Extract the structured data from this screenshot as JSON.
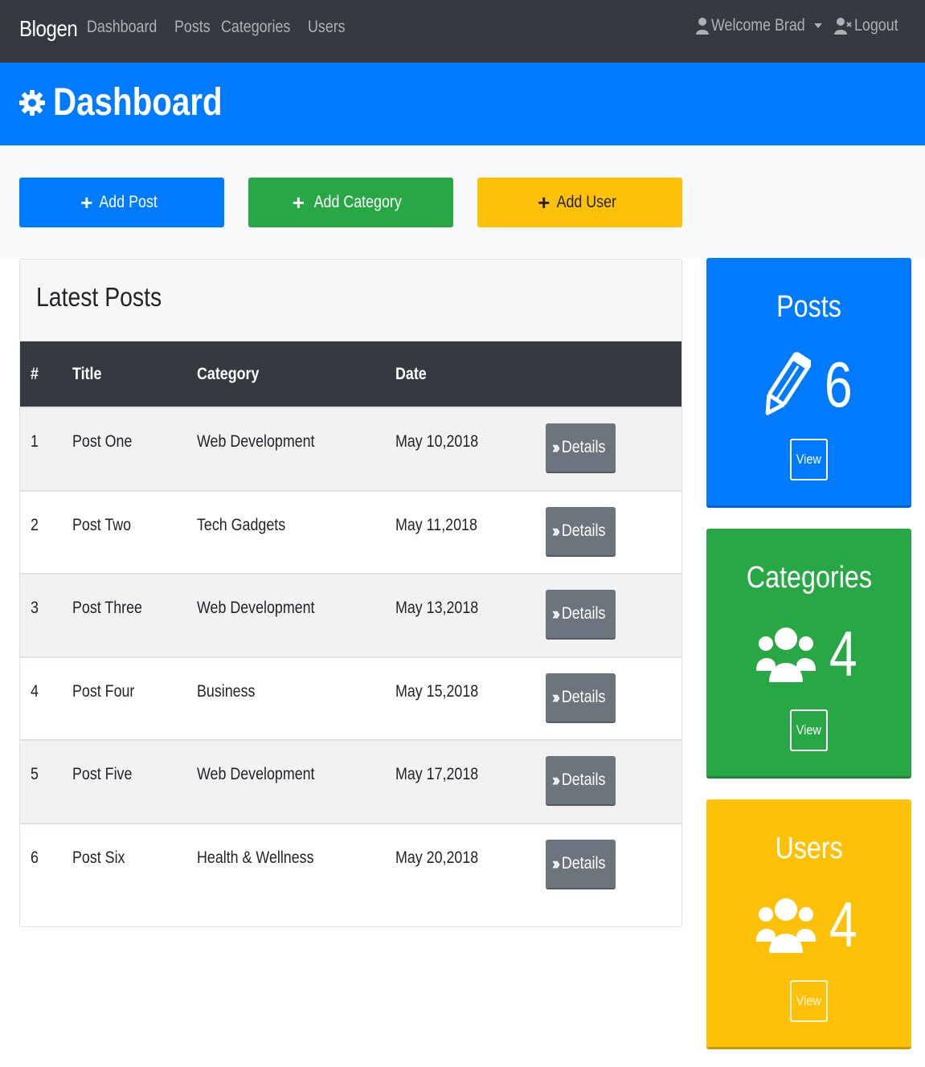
{
  "navbar": {
    "brand": "Blogen",
    "links": [
      "Dashboard",
      "Posts",
      "Categories",
      "Users"
    ],
    "welcome": "Welcome Brad",
    "logout": "Logout"
  },
  "header": {
    "title": "Dashboard",
    "icon": "gear-icon"
  },
  "actions": {
    "add_post": "Add Post",
    "add_category": "Add Category",
    "add_user": "Add User"
  },
  "latest_posts": {
    "title": "Latest Posts",
    "columns": [
      "#",
      "Title",
      "Category",
      "Date"
    ],
    "details_label": "Details",
    "rows": [
      {
        "num": "1",
        "title": "Post One",
        "category": "Web Development",
        "date": "May 10,2018"
      },
      {
        "num": "2",
        "title": "Post Two",
        "category": "Tech Gadgets",
        "date": "May 11,2018"
      },
      {
        "num": "3",
        "title": "Post Three",
        "category": "Web Development",
        "date": "May 13,2018"
      },
      {
        "num": "4",
        "title": "Post Four",
        "category": "Business",
        "date": "May 15,2018"
      },
      {
        "num": "5",
        "title": "Post Five",
        "category": "Web Development",
        "date": "May 17,2018"
      },
      {
        "num": "6",
        "title": "Post Six",
        "category": "Health & Wellness",
        "date": "May 20,2018"
      }
    ]
  },
  "stats": {
    "posts": {
      "title": "Posts",
      "count": "6",
      "view": "View",
      "icon": "pencil-icon"
    },
    "categories": {
      "title": "Categories",
      "count": "4",
      "view": "View",
      "icon": "users-icon"
    },
    "users": {
      "title": "Users",
      "count": "4",
      "view": "View",
      "icon": "users-icon"
    }
  },
  "colors": {
    "navbar": "#343a40",
    "primary": "#007bff",
    "success": "#28a745",
    "warning": "#ffc107",
    "secondary": "#6c757d"
  }
}
